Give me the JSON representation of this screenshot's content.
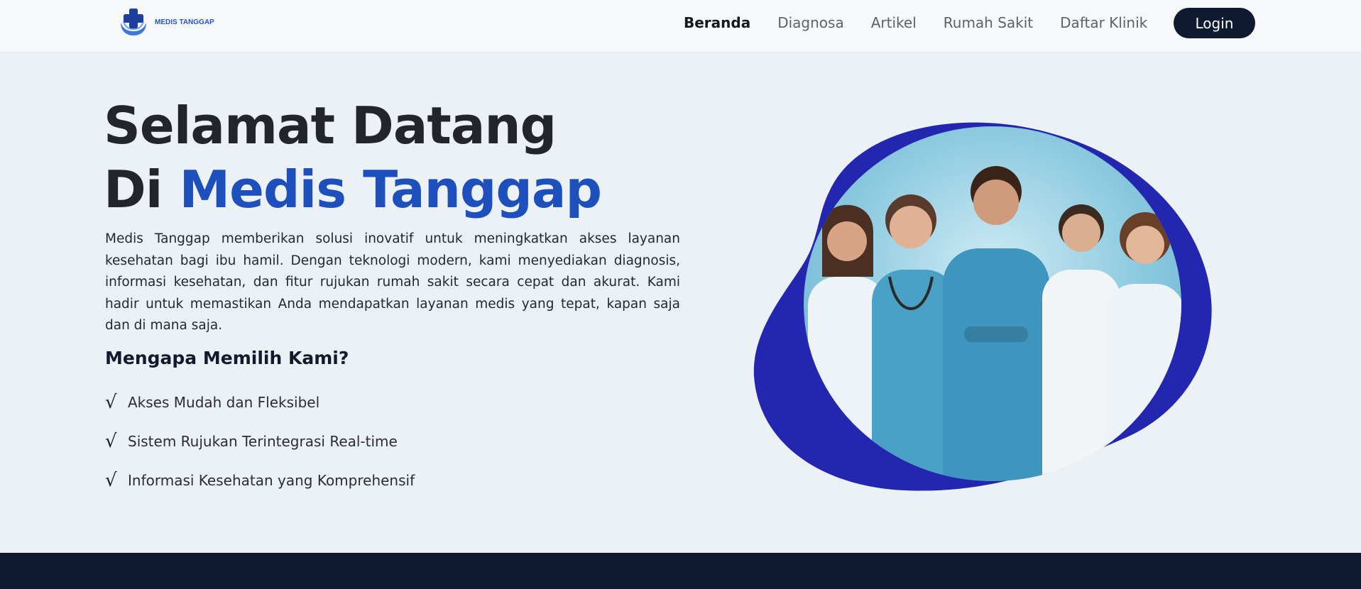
{
  "brand": {
    "name": "MEDIS TANGGAP",
    "colors": {
      "primary": "#1d4fbd",
      "dark": "#0e1a2f",
      "blob": "#2327b0"
    }
  },
  "nav": {
    "items": [
      {
        "label": "Beranda",
        "active": true
      },
      {
        "label": "Diagnosa",
        "active": false
      },
      {
        "label": "Artikel",
        "active": false
      },
      {
        "label": "Rumah Sakit",
        "active": false
      },
      {
        "label": "Daftar Klinik",
        "active": false
      }
    ],
    "login_label": "Login"
  },
  "hero": {
    "title_line1": "Selamat Datang",
    "title_line2_prefix": "Di",
    "title_line2_accent": "Medis Tanggap",
    "description": "Medis Tanggap memberikan solusi inovatif untuk meningkatkan akses layanan kesehatan bagi ibu hamil. Dengan teknologi modern, kami menyediakan diagnosis, informasi kesehatan, dan fitur rujukan rumah sakit secara cepat dan akurat. Kami hadir untuk memastikan Anda mendapatkan layanan medis yang tepat, kapan saja dan di mana saja.",
    "why_heading": "Mengapa Memilih Kami?",
    "features": [
      {
        "icon": "check-icon",
        "glyph": "√",
        "label": "Akses Mudah dan Fleksibel"
      },
      {
        "icon": "check-icon",
        "glyph": "√",
        "label": "Sistem Rujukan Terintegrasi Real-time"
      },
      {
        "icon": "check-icon",
        "glyph": "√",
        "label": "Informasi Kesehatan yang Komprehensif"
      }
    ]
  }
}
